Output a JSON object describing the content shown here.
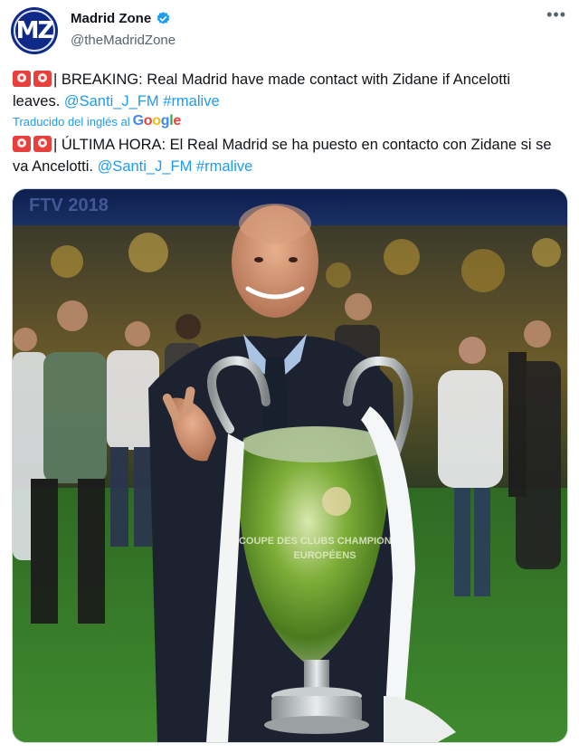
{
  "author": {
    "name": "Madrid Zone",
    "handle": "@theMadridZone",
    "avatar_text": "MZ",
    "verified": true
  },
  "tweet": {
    "english": {
      "prefix": "| BREAKING: Real Madrid have made contact with Zidane if Ancelotti leaves. ",
      "mention": "@Santi_J_FM",
      "hashtag": "#rmalive"
    },
    "translation": {
      "label": "Traducido del inglés al",
      "provider": [
        "G",
        "o",
        "o",
        "g",
        "l",
        "e"
      ]
    },
    "spanish": {
      "prefix": "| ÚLTIMA HORA: El Real Madrid se ha puesto en contacto con Zidane si se va Ancelotti. ",
      "mention": "@Santi_J_FM",
      "hashtag": "#rmalive"
    }
  },
  "photo": {
    "banner_text": "FTV 2018",
    "trophy_text_1": "COUPE DES CLUBS CHAMPIONS",
    "trophy_text_2": "EUROPÉENS"
  },
  "icons": {
    "more": "more-icon",
    "verified": "verified-badge-icon"
  },
  "colors": {
    "accent": "#1d9bf0",
    "avatar_bg": "#0f2a86"
  }
}
